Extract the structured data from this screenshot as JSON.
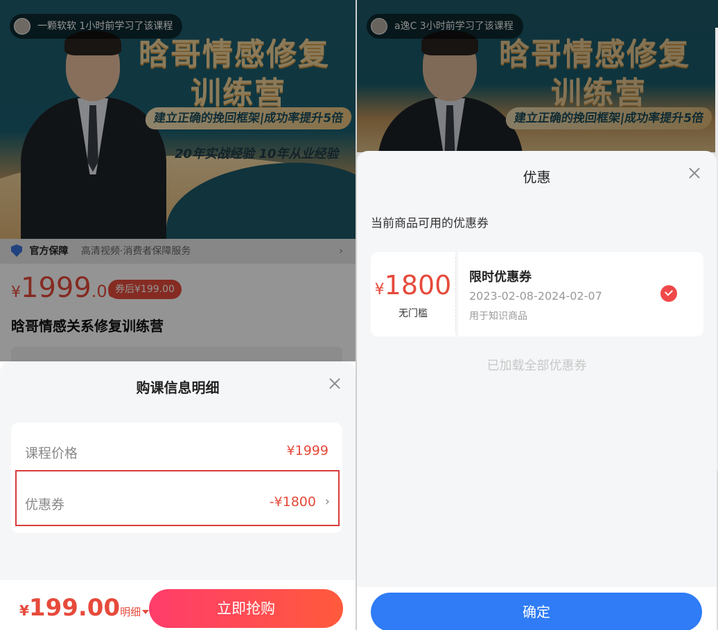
{
  "left": {
    "toast": "一颗软软  1小时前学习了该课程",
    "banner": {
      "title_line1": "晗哥情感修复",
      "title_line2": "训练营",
      "subtitle": "建立正确的挽回框架|成功率提升5倍",
      "experience": "20年实战经验 10年从业经验"
    },
    "guarantee": {
      "title": "官方保障",
      "text": "高清视频·消费者保障服务",
      "chevron": "›"
    },
    "price": {
      "symbol": "¥",
      "integer": "1999",
      "decimal": ".00",
      "after_coupon": "券后¥199.00"
    },
    "course_title": "晗哥情感关系修复训练营",
    "sheet": {
      "title": "购课信息明细",
      "rows": [
        {
          "label": "课程价格",
          "value": "¥1999"
        },
        {
          "label": "优惠券",
          "value": "-¥1800",
          "chevron": "›"
        }
      ]
    },
    "bottom": {
      "symbol": "¥",
      "final_price": "199.00",
      "detail_label": "明细",
      "buy_label": "立即抢购"
    }
  },
  "right": {
    "toast": "a逸C  3小时前学习了该课程",
    "banner": {
      "title_line1": "晗哥情感修复",
      "title_line2": "训练营",
      "subtitle": "建立正确的挽回框架|成功率提升5倍"
    },
    "sheet": {
      "title": "优惠",
      "available_label": "当前商品可用的优惠券",
      "coupon": {
        "symbol": "¥",
        "amount": "1800",
        "threshold": "无门槛",
        "name": "限时优惠券",
        "date_range": "2023-02-08-2024-02-07",
        "usage": "用于知识商品",
        "selected": true
      },
      "loaded_text": "已加载全部优惠券",
      "confirm_label": "确定"
    }
  },
  "colors": {
    "accent_red": "#e64a3b",
    "confirm_blue": "#2f7cf6",
    "highlight_border": "#d83b3b"
  }
}
